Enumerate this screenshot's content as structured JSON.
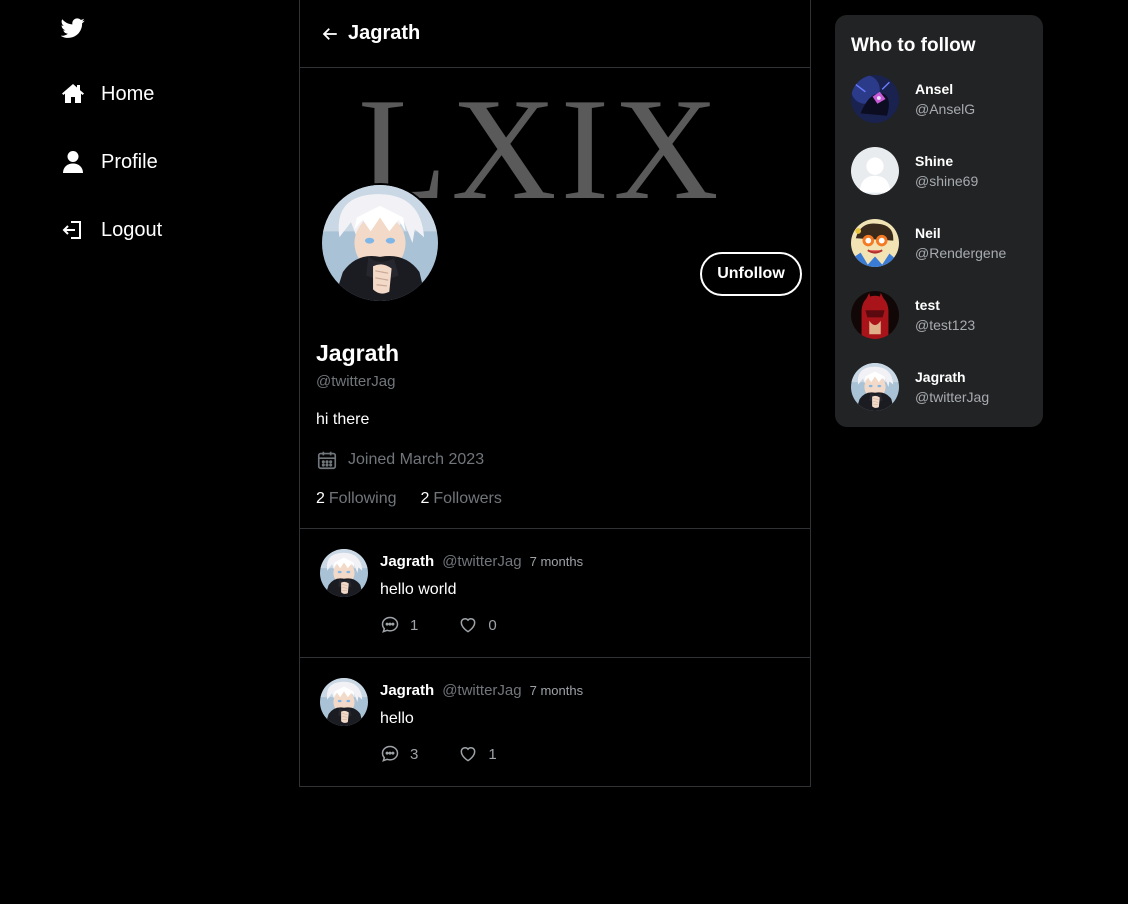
{
  "nav": {
    "logo_icon": "twitter-bird-icon",
    "items": [
      {
        "label": "Home",
        "icon": "home-icon"
      },
      {
        "label": "Profile",
        "icon": "user-icon"
      },
      {
        "label": "Logout",
        "icon": "logout-icon"
      }
    ]
  },
  "header": {
    "back_icon": "arrow-left-icon",
    "title": "Jagrath"
  },
  "profile": {
    "banner_text": "LXIX",
    "name": "Jagrath",
    "handle": "@twitterJag",
    "bio": "hi there",
    "joined": "Joined March 2023",
    "following_count": "2",
    "following_label": "Following",
    "followers_count": "2",
    "followers_label": "Followers",
    "unfollow_label": "Unfollow"
  },
  "tweets": [
    {
      "name": "Jagrath",
      "handle": "@twitterJag",
      "time": "7 months",
      "text": "hello world",
      "replies": "1",
      "likes": "0"
    },
    {
      "name": "Jagrath",
      "handle": "@twitterJag",
      "time": "7 months",
      "text": "hello",
      "replies": "3",
      "likes": "1"
    }
  ],
  "who_to_follow": {
    "title": "Who to follow",
    "users": [
      {
        "name": "Ansel",
        "handle": "@AnselG"
      },
      {
        "name": "Shine",
        "handle": "@shine69"
      },
      {
        "name": "Neil",
        "handle": "@Rendergene"
      },
      {
        "name": "test",
        "handle": "@test123"
      },
      {
        "name": "Jagrath",
        "handle": "@twitterJag"
      }
    ]
  },
  "colors": {
    "background": "#000000",
    "muted_text": "#71767b",
    "card_background": "#222324",
    "border": "#2f3336"
  }
}
